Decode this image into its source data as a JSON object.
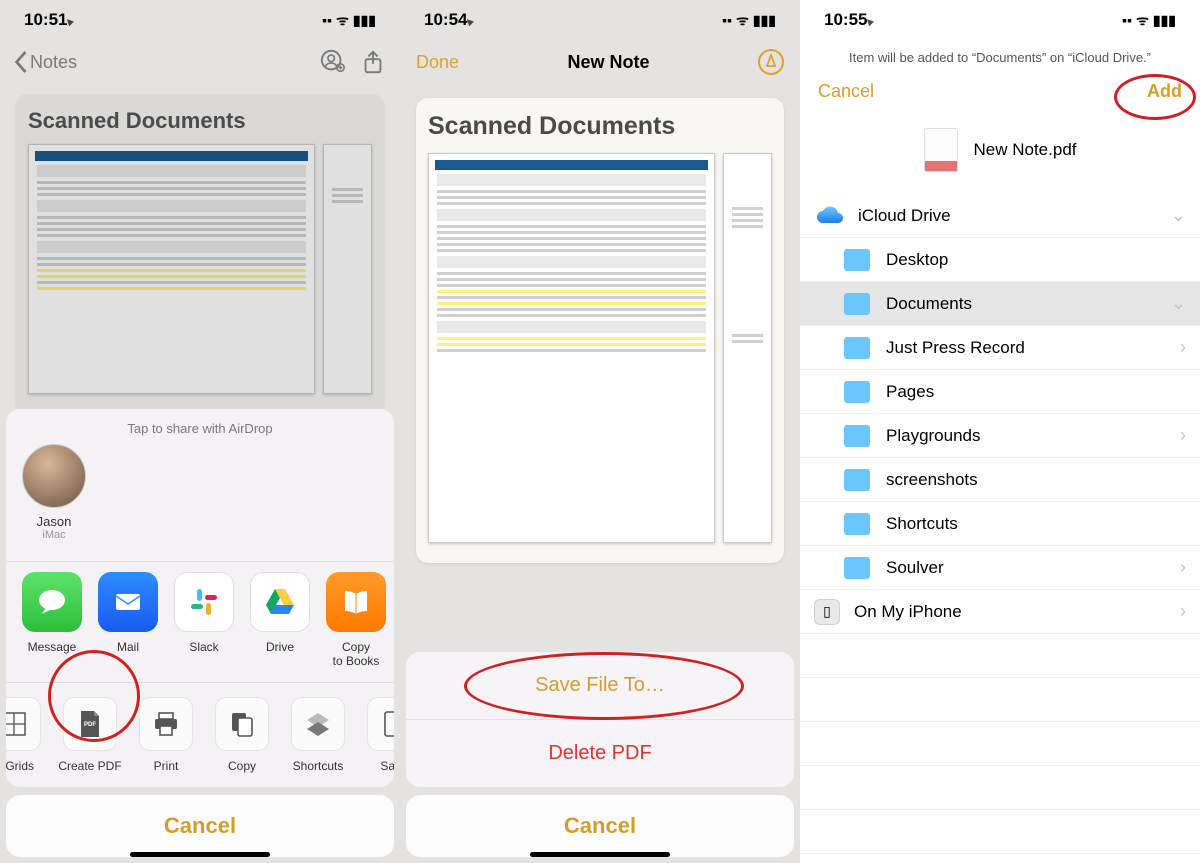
{
  "screen1": {
    "time": "10:51",
    "back": "Notes",
    "note_title": "Scanned Documents",
    "airdrop_hint": "Tap to share with AirDrop",
    "contact_name": "Jason",
    "contact_device": "iMac",
    "apps": [
      {
        "label": "Message"
      },
      {
        "label": "Mail"
      },
      {
        "label": "Slack"
      },
      {
        "label": "Drive"
      },
      {
        "label": "Copy\nto Books"
      }
    ],
    "actions": [
      {
        "label": "& Grids"
      },
      {
        "label": "Create PDF"
      },
      {
        "label": "Print"
      },
      {
        "label": "Copy"
      },
      {
        "label": "Shortcuts"
      },
      {
        "label": "Save"
      }
    ],
    "cancel": "Cancel"
  },
  "screen2": {
    "time": "10:54",
    "done": "Done",
    "title": "New Note",
    "note_title": "Scanned Documents",
    "save": "Save File To…",
    "delete": "Delete PDF",
    "cancel": "Cancel"
  },
  "screen3": {
    "time": "10:55",
    "subtext": "Item will be added to “Documents” on “iCloud Drive.”",
    "cancel": "Cancel",
    "add": "Add",
    "file_name": "New Note.pdf",
    "icloud": "iCloud Drive",
    "folders": [
      {
        "label": "Desktop",
        "chev": false
      },
      {
        "label": "Documents",
        "chev": true,
        "selected": true
      },
      {
        "label": "Just Press Record",
        "chev": true
      },
      {
        "label": "Pages",
        "chev": false
      },
      {
        "label": "Playgrounds",
        "chev": true
      },
      {
        "label": "screenshots",
        "chev": false
      },
      {
        "label": "Shortcuts",
        "chev": false
      },
      {
        "label": "Soulver",
        "chev": true
      }
    ],
    "device": "On My iPhone"
  }
}
